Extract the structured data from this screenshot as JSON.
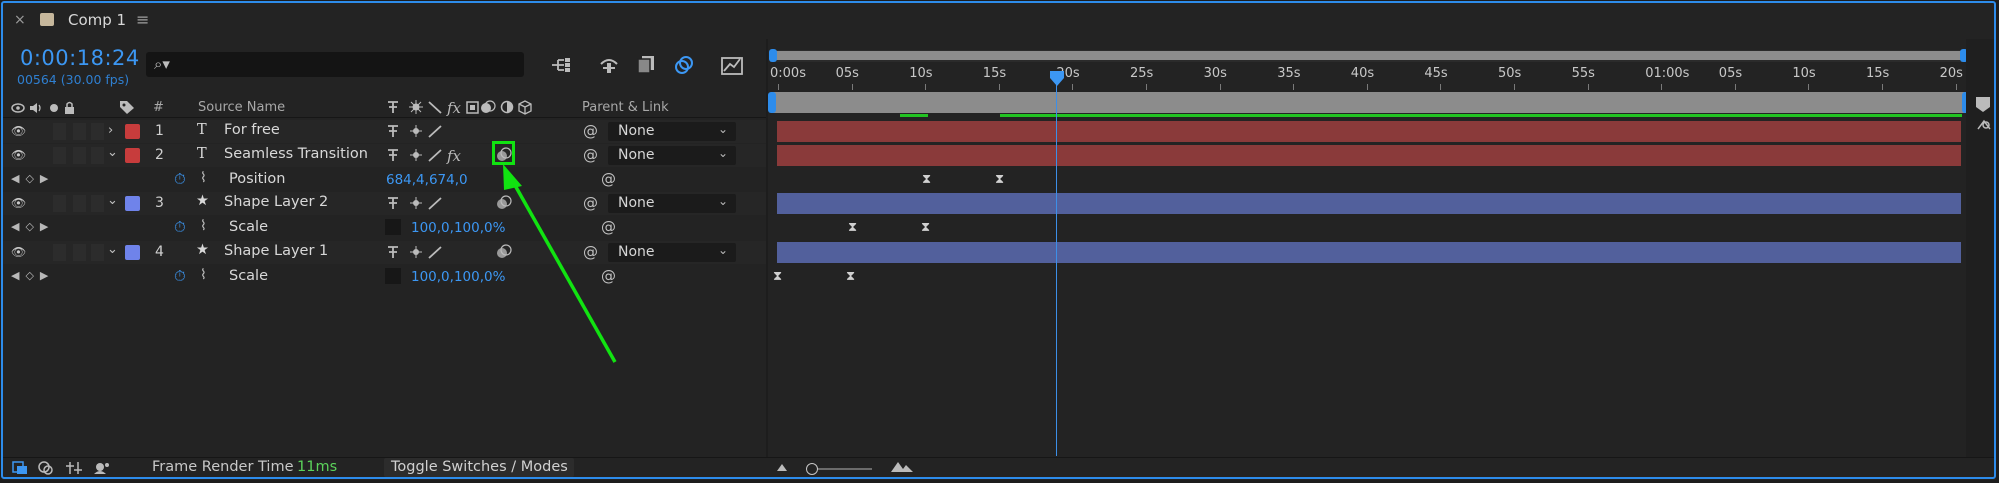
{
  "tab": {
    "close": "×",
    "title": "Comp 1",
    "menu": "≡"
  },
  "header": {
    "timecode": "0:00:18:24",
    "frames": "00564 (30.00 fps)",
    "search_glyph": "⌕▾",
    "col_num": "#",
    "col_source": "Source Name",
    "col_parent": "Parent & Link"
  },
  "layers": [
    {
      "num": "1",
      "type_icon": "T",
      "name": "For free",
      "color": "#c73c3c",
      "parent": "None"
    },
    {
      "num": "2",
      "type_icon": "T",
      "name": "Seamless Transition",
      "color": "#c73c3c",
      "parent": "None"
    },
    {
      "prop": "Position",
      "value": "684,4,674,0"
    },
    {
      "num": "3",
      "type_icon": "★",
      "name": "Shape Layer 2",
      "color": "#6f83ea",
      "parent": "None"
    },
    {
      "prop": "Scale",
      "value": "100,0,100,0%"
    },
    {
      "num": "4",
      "type_icon": "★",
      "name": "Shape Layer 1",
      "color": "#6f83ea",
      "parent": "None"
    },
    {
      "prop": "Scale",
      "value": "100,0,100,0%"
    }
  ],
  "ruler_ticks": [
    "0:00s",
    "05s",
    "10s",
    "15s",
    "20s",
    "25s",
    "30s",
    "35s",
    "40s",
    "45s",
    "50s",
    "55s",
    "01:00s",
    "05s",
    "10s",
    "15s",
    "20s"
  ],
  "colors": {
    "accent": "#2d8ceb",
    "red_bar": "#8a3a3a",
    "blue_bar": "#52609c",
    "annotation": "#11e311",
    "green_cache": "#22c322"
  },
  "bottom": {
    "frame_render_label": "Frame Render Time",
    "frame_render_value": "11ms",
    "toggle_label": "Toggle Switches / Modes"
  },
  "icons": {
    "eye": "eye-icon",
    "audio": "audio-icon",
    "solo": "solo-icon",
    "lock": "lock-icon",
    "label": "label-tag-icon",
    "stopwatch": "stopwatch-icon",
    "graph": "graph-icon",
    "motion_blur": "motion-blur-icon",
    "keyframe": "keyframe-icon"
  }
}
